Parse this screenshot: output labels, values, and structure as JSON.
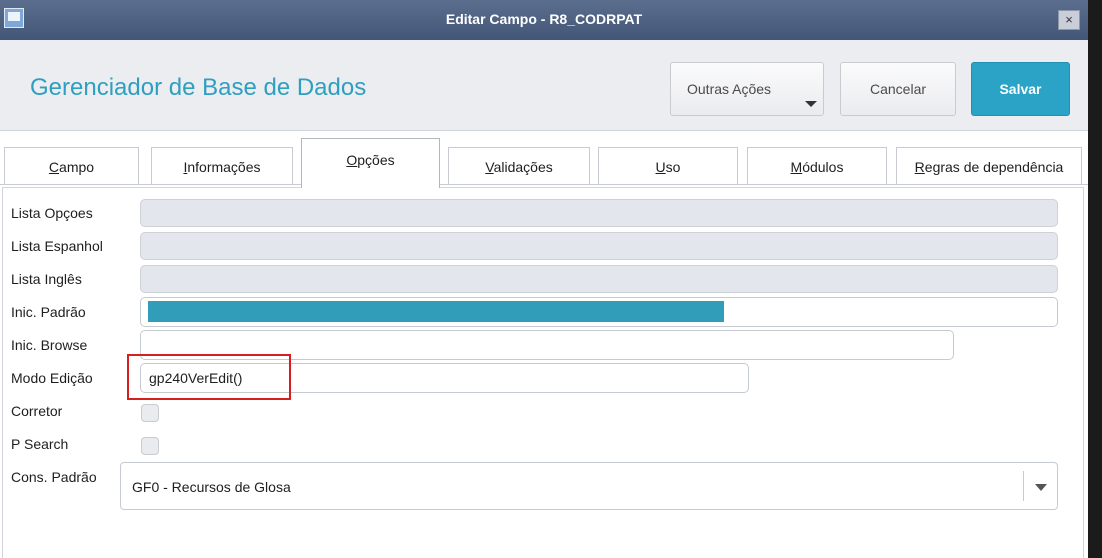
{
  "window": {
    "title": "Editar Campo - R8_CODRPAT",
    "close_label": "×"
  },
  "header": {
    "app_title": "Gerenciador de Base de Dados",
    "buttons": {
      "other_actions": "Outras Ações",
      "cancel": "Cancelar",
      "save": "Salvar"
    }
  },
  "tabs": [
    {
      "first": "C",
      "rest": "ampo"
    },
    {
      "first": "I",
      "rest": "nformações"
    },
    {
      "first": "O",
      "rest": "pções"
    },
    {
      "first": "V",
      "rest": "alidações"
    },
    {
      "first": "U",
      "rest": "so"
    },
    {
      "first": "M",
      "rest": "ódulos"
    },
    {
      "first": "R",
      "rest": "egras de dependência"
    }
  ],
  "active_tab": "Opções",
  "form": {
    "lista_opcoes": {
      "label": "Lista Opçoes",
      "value": ""
    },
    "lista_espanhol": {
      "label": "Lista Espanhol",
      "value": ""
    },
    "lista_ingles": {
      "label": "Lista Inglês",
      "value": ""
    },
    "inic_padrao": {
      "label": "Inic. Padrão",
      "value": ""
    },
    "inic_browse": {
      "label": "Inic. Browse",
      "value": ""
    },
    "modo_edicao": {
      "label": "Modo Edição",
      "value": "gp240VerEdit()"
    },
    "corretor": {
      "label": "Corretor",
      "checked": false
    },
    "p_search": {
      "label": "P Search",
      "checked": false
    },
    "cons_padrao": {
      "label": "Cons. Padrão",
      "value": "GF0 - Recursos de Glosa"
    }
  },
  "colors": {
    "accent": "#2aa3c7",
    "title_bar": "#4d5f80",
    "highlight_border": "#d81e1e"
  }
}
